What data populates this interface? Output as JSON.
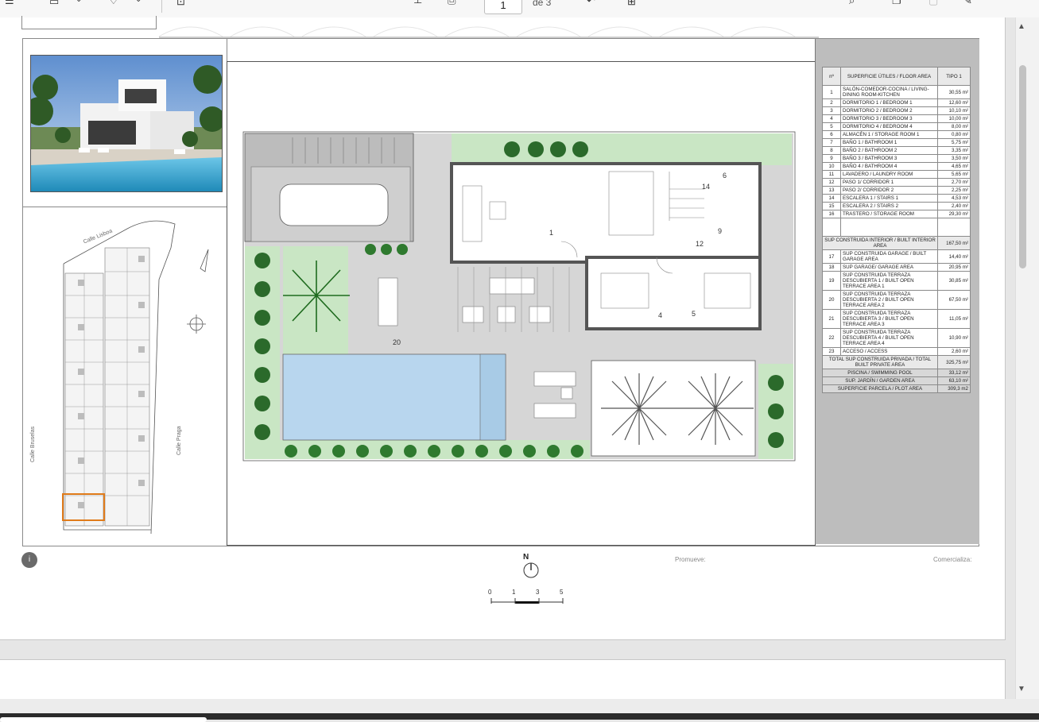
{
  "toolbar": {
    "page_current": "1",
    "page_total_label": "de 3",
    "icons": [
      "menu-icon",
      "highlight-icon",
      "chevron-down-icon",
      "pen-icon",
      "chevron-down-icon",
      "page-view-icon",
      "cursor-icon",
      "print-icon",
      "page-number-input",
      "rotate-icon",
      "fit-page-icon",
      "search-icon",
      "copy-icon",
      "delete-icon",
      "edit-icon"
    ]
  },
  "site_plan": {
    "street_top": "Calle Lisboa",
    "street_left": "Calle Bruselas",
    "street_right": "Calle Praga"
  },
  "floor_plan": {
    "room_labels": [
      "1",
      "4",
      "5",
      "6",
      "9",
      "12",
      "14",
      "20"
    ]
  },
  "area_table": {
    "header": {
      "n": "nº",
      "name": "SUPERFICIE ÚTILES / FLOOR AREA",
      "type": "TIPO 1"
    },
    "rows": [
      {
        "n": "1",
        "name": "SALÓN-COMEDOR-COCINA / LIVING-DINING ROOM-KITCHEN",
        "value": "30,55 m²"
      },
      {
        "n": "2",
        "name": "DORMITORIO 1 / BEDROOM 1",
        "value": "12,60 m²"
      },
      {
        "n": "3",
        "name": "DORMITORIO 2 / BEDROOM 2",
        "value": "10,10 m²"
      },
      {
        "n": "4",
        "name": "DORMITORIO 3 / BEDROOM 3",
        "value": "10,00 m²"
      },
      {
        "n": "5",
        "name": "DORMITORIO 4 / BEDROOM 4",
        "value": "8,00 m²"
      },
      {
        "n": "6",
        "name": "ALMACÉN 1 / STORAGE ROOM 1",
        "value": "0,80 m²"
      },
      {
        "n": "7",
        "name": "BAÑO 1 / BATHROOM 1",
        "value": "5,75 m²"
      },
      {
        "n": "8",
        "name": "BAÑO 2 / BATHROOM 2",
        "value": "3,35 m²"
      },
      {
        "n": "9",
        "name": "BAÑO 3 / BATHROOM 3",
        "value": "3,50 m²"
      },
      {
        "n": "10",
        "name": "BAÑO 4 / BATHROOM 4",
        "value": "4,65 m²"
      },
      {
        "n": "11",
        "name": "LAVADERO / LAUNDRY ROOM",
        "value": "5,65 m²"
      },
      {
        "n": "12",
        "name": "PASO 1/ CORRIDOR 1",
        "value": "2,70 m²"
      },
      {
        "n": "13",
        "name": "PASO 2/ CORRIDOR 2",
        "value": "2,25 m²"
      },
      {
        "n": "14",
        "name": "ESCALERA 1 / STAIRS 1",
        "value": "4,53 m²"
      },
      {
        "n": "15",
        "name": "ESCALERA 2 / STAIRS 2",
        "value": "2,40 m²"
      },
      {
        "n": "16",
        "name": "TRASTERO / STORAGE ROOM",
        "value": "29,30 m²"
      }
    ],
    "interior_total": {
      "name": "SUP CONSTRUIDA INTERIOR / BUILT INTERIOR AREA",
      "value": "167,50 m²"
    },
    "rows2": [
      {
        "n": "17",
        "name": "SUP CONSTRUIDA GARAGE / BUILT GARAGE AREA",
        "value": "14,40 m²"
      },
      {
        "n": "18",
        "name": "SUP GARAGE/ GARAGE AREA",
        "value": "20,95 m²"
      },
      {
        "n": "19",
        "name": "SUP CONSTRUIDA TERRAZA DESCUBIERTA 1 / BUILT OPEN TERRACE AREA 1",
        "value": "30,85 m²"
      },
      {
        "n": "20",
        "name": "SUP CONSTRUIDA TERRAZA DESCUBIERTA 2 / BUILT OPEN TERRACE AREA 2",
        "value": "67,50 m²"
      },
      {
        "n": "21",
        "name": "SUP CONSTRUIDA TERRAZA DESCUBIERTA 3 / BUILT OPEN TERRACE AREA 3",
        "value": "11,05 m²"
      },
      {
        "n": "22",
        "name": "SUP CONSTRUIDA TERRAZA DESCUBIERTA 4 / BUILT OPEN TERRACE AREA 4",
        "value": "10,90 m²"
      },
      {
        "n": "23",
        "name": "ACCESO / ACCESS",
        "value": "2,60 m²"
      }
    ],
    "total_private": {
      "name": "TOTAL SUP CONSTRUIDA PRIVADA / TOTAL BUILT PRIVATE AREA",
      "value": "325,75 m²"
    },
    "pool": {
      "name": "PISCINA / SWIMMING POOL",
      "value": "33,12 m²"
    },
    "garden": {
      "name": "SUP. JARDÍN / GARDEN AREA",
      "value": "63,10 m²"
    },
    "plot": {
      "name": "SUPERFICIE PARCELA / PLOT AREA",
      "value": "309,3 m2"
    }
  },
  "footer": {
    "info": "i",
    "north": "N",
    "promueve": "Promueve:",
    "comercializa": "Comercializa:",
    "scale": [
      "0",
      "1",
      "3",
      "5"
    ]
  },
  "colors": {
    "garden": "#c9e6c4",
    "pool": "#b8d6ee",
    "terrace": "#cfcfcf",
    "wall": "#555555",
    "accent_plot": "#e07b1a"
  }
}
